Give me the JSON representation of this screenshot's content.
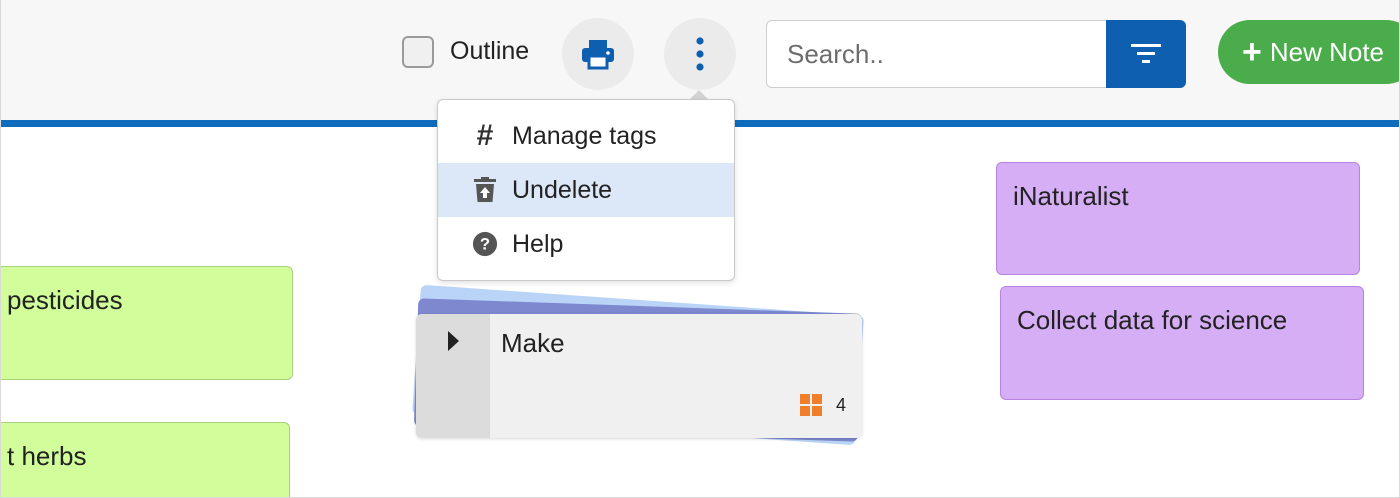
{
  "toolbar": {
    "outline_label": "Outline",
    "search_placeholder": "Search..",
    "new_note_label": "New Note"
  },
  "menu": {
    "items": [
      {
        "label": "Manage tags",
        "icon": "hash-icon"
      },
      {
        "label": "Undelete",
        "icon": "trash-restore-icon"
      },
      {
        "label": "Help",
        "icon": "question-circle-icon"
      }
    ]
  },
  "cards": {
    "pesticides": "pesticides",
    "herbs": "t herbs",
    "inaturalist": "iNaturalist",
    "collect": "Collect data for science",
    "stack_title": "Make",
    "stack_count": "4"
  },
  "colors": {
    "accent_blue": "#0f6cbd",
    "green_button": "#4aac4a",
    "green_card": "#d1fd9b",
    "purple_card": "#d6aef5",
    "stack_orange": "#f07f2b"
  }
}
